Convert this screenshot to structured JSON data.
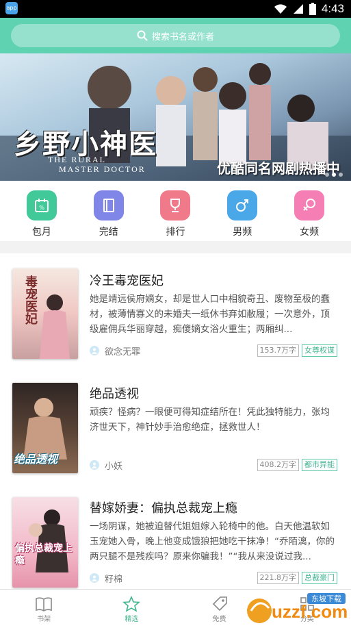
{
  "status": {
    "time": "4:43",
    "app_icon_text": "app"
  },
  "search": {
    "placeholder": "搜索书名或作者"
  },
  "banner": {
    "title": "乡野小神医",
    "subtitle_line1": "THE RURAL",
    "subtitle_line2": "MASTER DOCTOR",
    "tagline": "优酷同名网剧热播中"
  },
  "categories": [
    {
      "label": "包月",
      "color": "#42c99a",
      "icon": "calendar-icon"
    },
    {
      "label": "完结",
      "color": "#7f86e8",
      "icon": "book-icon"
    },
    {
      "label": "排行",
      "color": "#f07a8a",
      "icon": "trophy-icon"
    },
    {
      "label": "男频",
      "color": "#4aa8e8",
      "icon": "male-icon"
    },
    {
      "label": "女频",
      "color": "#f57fb4",
      "icon": "female-icon"
    }
  ],
  "books": [
    {
      "title": "冷王毒宠医妃",
      "description": "她是靖远侯府嫡女，却是世人口中相貌奇丑、废物至极的蠢材，被薄情寡义的未婚夫一纸休书弃如敝履；一次意外，顶级雇佣兵华丽穿越，痴傻嫡女浴火重生；两厢纠...",
      "author": "欲念无罪",
      "words": "153.7万字",
      "genre": "女尊权谋",
      "cover_text": "毒宠医妃"
    },
    {
      "title": "绝品透视",
      "description": "顽疾？怪病？一眼便可得知症结所在！凭此独特能力，张均济世天下，神针妙手治愈绝症，拯救世人！",
      "author": "小妖",
      "words": "408.2万字",
      "genre": "都市异能",
      "cover_text": "绝品透视"
    },
    {
      "title": "替嫁娇妻：偏执总裁宠上瘾",
      "description": "一场阴谋，她被迫替代姐姐嫁入轮椅中的他。白天他温软如玉宠她入骨，晚上他变成饿狼把她吃干抹净！“乔陌漓，你的两只腿不是残疾吗？原来你骗我！”“我从来没说过我...",
      "author": "籽棉",
      "words": "221.8万字",
      "genre": "总裁豪门",
      "cover_text": "偏执总裁宠上瘾"
    }
  ],
  "tabs": [
    {
      "label": "书架",
      "icon": "book-open-icon",
      "active": false
    },
    {
      "label": "精选",
      "icon": "star-icon",
      "active": true
    },
    {
      "label": "免费",
      "icon": "tag-icon",
      "active": false
    },
    {
      "label": "分类",
      "icon": "grid-icon",
      "active": false
    }
  ],
  "watermark": {
    "brand": "uzzf.com",
    "label": "东坡下载"
  },
  "colors": {
    "accent": "#5fd2b2",
    "active_tab": "#3fb48f"
  }
}
